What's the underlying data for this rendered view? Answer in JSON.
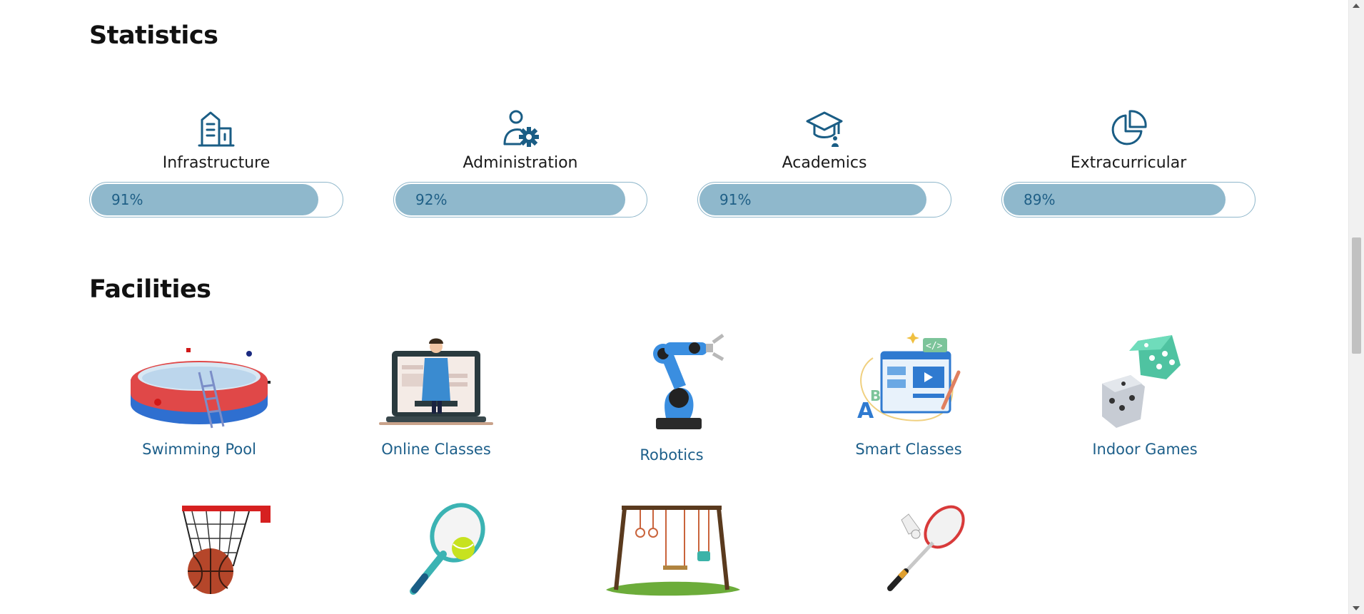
{
  "statistics": {
    "title": "Statistics",
    "items": [
      {
        "label": "Infrastructure",
        "percent": "91%",
        "level": 0.91,
        "icon": "building-icon"
      },
      {
        "label": "Administration",
        "percent": "92%",
        "level": 0.92,
        "icon": "user-gear-icon"
      },
      {
        "label": "Academics",
        "percent": "91%",
        "level": 0.91,
        "icon": "graduation-cap-icon"
      },
      {
        "label": "Extracurricular",
        "percent": "89%",
        "level": 0.89,
        "icon": "pie-chart-icon"
      }
    ]
  },
  "facilities": {
    "title": "Facilities",
    "items": [
      {
        "label": "Swimming Pool",
        "icon": "swimming-pool-image"
      },
      {
        "label": "Online Classes",
        "icon": "online-classes-image"
      },
      {
        "label": "Robotics",
        "icon": "robotic-arm-image"
      },
      {
        "label": "Smart Classes",
        "icon": "smart-classes-image"
      },
      {
        "label": "Indoor Games",
        "icon": "dice-image"
      },
      {
        "label": "",
        "icon": "basketball-hoop-image"
      },
      {
        "label": "",
        "icon": "tennis-racket-image"
      },
      {
        "label": "",
        "icon": "swing-set-image"
      },
      {
        "label": "",
        "icon": "badminton-racket-image"
      }
    ]
  },
  "colors": {
    "accent": "#1d5f8a",
    "bar_fill": "#8fb8cc",
    "icon": "#1a5d85"
  }
}
